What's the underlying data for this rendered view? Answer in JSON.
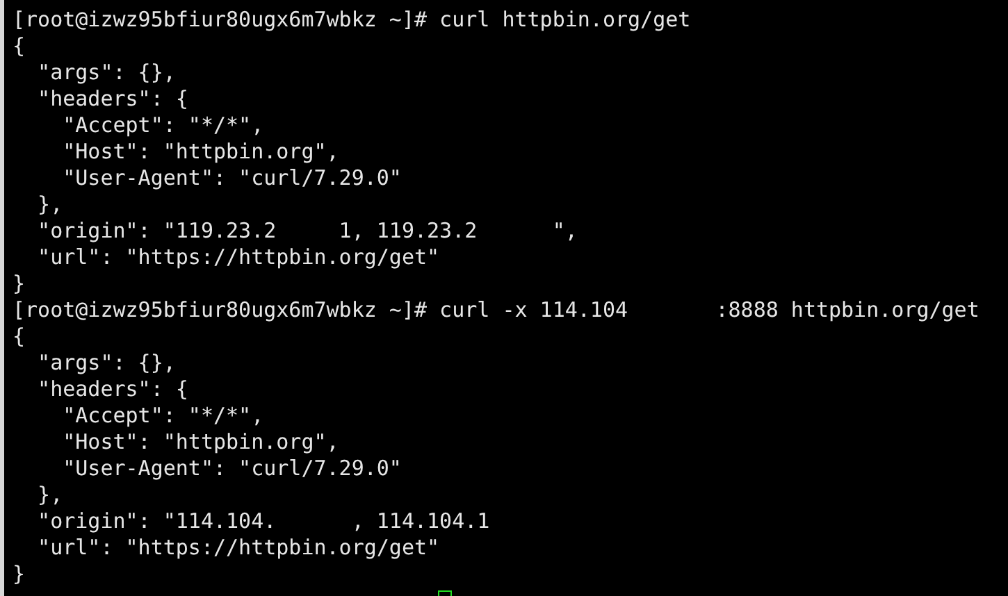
{
  "terminal": {
    "lines": [
      "[root@izwz95bfiur80ugx6m7wbkz ~]# curl httpbin.org/get",
      "{",
      "  \"args\": {},",
      "  \"headers\": {",
      "    \"Accept\": \"*/*\",",
      "    \"Host\": \"httpbin.org\",",
      "    \"User-Agent\": \"curl/7.29.0\"",
      "  },",
      "  \"origin\": \"119.23.2     1, 119.23.2      \",",
      "  \"url\": \"https://httpbin.org/get\"",
      "}",
      "[root@izwz95bfiur80ugx6m7wbkz ~]# curl -x 114.104       :8888 httpbin.org/get",
      "{",
      "  \"args\": {},",
      "  \"headers\": {",
      "    \"Accept\": \"*/*\",",
      "    \"Host\": \"httpbin.org\",",
      "    \"User-Agent\": \"curl/7.29.0\"",
      "  },",
      "  \"origin\": \"114.104.      , 114.104.1",
      "  \"url\": \"https://httpbin.org/get\"",
      "}"
    ]
  }
}
